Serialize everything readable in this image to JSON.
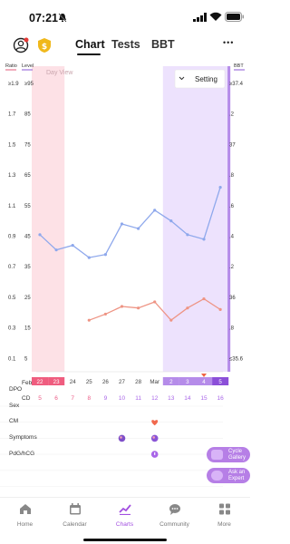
{
  "status_bar": {
    "time": "07:21",
    "mute": "bell-muted-icon",
    "signal": "signal-icon",
    "wifi": "wifi-icon",
    "battery": "battery-icon"
  },
  "header": {
    "tabs": [
      {
        "label": "Chart",
        "active": true
      },
      {
        "label": "Tests",
        "active": false
      },
      {
        "label": "BBT",
        "active": false
      }
    ],
    "more": "•••"
  },
  "chart_data": {
    "type": "line",
    "left_axis_headers": [
      "Ratio",
      "Level"
    ],
    "right_axis_header": "BBT",
    "ratio_ticks": [
      "≥1.9",
      "1.7",
      "1.5",
      "1.3",
      "1.1",
      "0.9",
      "0.7",
      "0.5",
      "0.3",
      "0.1"
    ],
    "level_ticks": [
      "≥95",
      "85",
      "75",
      "65",
      "55",
      "45",
      "35",
      "25",
      "15",
      "5"
    ],
    "bbt_ticks": [
      "≥37.4",
      ".2",
      "37",
      ".8",
      ".6",
      ".4",
      ".2",
      "36",
      ".8",
      "≤35.6"
    ],
    "day_view_label": "Day View",
    "setting_label": "Setting",
    "x_dates": [
      "22",
      "23",
      "24",
      "25",
      "26",
      "27",
      "28",
      "Mar",
      "2",
      "3",
      "4",
      "5"
    ],
    "month_label": "Feb",
    "cd_label": "CD",
    "cycle_days": [
      "5",
      "6",
      "7",
      "8",
      "9",
      "10",
      "11",
      "12",
      "13",
      "14",
      "15",
      "16"
    ],
    "series": [
      {
        "color": "#8ea8ec",
        "ratio": [
          0.71,
          0.61,
          0.64,
          0.56,
          0.58,
          0.78,
          0.75,
          0.87,
          0.8,
          0.71,
          0.68,
          1.02
        ]
      },
      {
        "color": "#ee9484",
        "ratio": [
          null,
          null,
          null,
          0.15,
          0.19,
          0.24,
          0.23,
          0.27,
          0.15,
          0.23,
          0.29,
          0.22
        ]
      }
    ],
    "period_days": [
      "22",
      "23"
    ],
    "fertile_days": [
      "2",
      "3",
      "4",
      "5"
    ],
    "colors": {
      "period": "#fde1e6",
      "period_strong": "#ef5d7f",
      "fertile": "#ede2fd",
      "fertile_strong": "#b58ce9",
      "fertile_deep": "#8b4fd8",
      "cd_pink": "#ec5b86",
      "cd_purple": "#a966e8",
      "marker": "#f06444"
    }
  },
  "rows": [
    {
      "label": "DPO"
    },
    {
      "label": "Sex",
      "marks": [
        {
          "day": "12",
          "icon": "heart-icon",
          "color": "#f1694e"
        }
      ]
    },
    {
      "label": "CM",
      "marks": [
        {
          "day": "10",
          "icon": "cm-icon",
          "color": "#7e4fc9"
        },
        {
          "day": "12",
          "icon": "cm-icon",
          "color": "#8a55d6"
        }
      ]
    },
    {
      "label": "Symptoms",
      "marks": [
        {
          "day": "12",
          "icon": "symptom-icon",
          "color": "#a966e8"
        }
      ]
    },
    {
      "label": "PdG/hCG"
    }
  ],
  "fabs": [
    {
      "label_line1": "Cycle",
      "label_line2": "Gallery",
      "icon": "gallery-icon"
    },
    {
      "label_line1": "Ask an",
      "label_line2": "Expert",
      "icon": "expert-icon"
    }
  ],
  "nav": [
    {
      "label": "Home",
      "icon": "home-icon",
      "active": false
    },
    {
      "label": "Calendar",
      "icon": "calendar-icon",
      "active": false
    },
    {
      "label": "Charts",
      "icon": "charts-icon",
      "active": true
    },
    {
      "label": "Community",
      "icon": "community-icon",
      "active": false
    },
    {
      "label": "More",
      "icon": "grid-icon",
      "active": false
    }
  ]
}
